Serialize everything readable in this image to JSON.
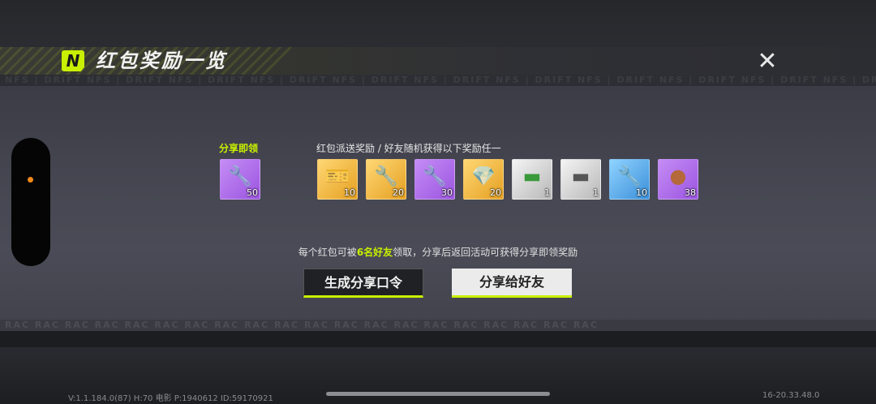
{
  "header": {
    "logo_letter": "N",
    "title": "红包奖励一览",
    "close_symbol": "✕"
  },
  "ticker_text": "NFS | DRIFT  NFS | DRIFT  NFS | DRIFT  NFS | DRIFT  NFS | DRIFT  NFS | DRIFT  NFS | DRIFT  NFS | DRIFT  NFS | DRIFT  NFS | DRIFT  NFS | DRIFT",
  "ticker2_text": "RAC   RAC   RAC   RAC   RAC   RAC   RAC   RAC   RAC   RAC   RAC   RAC   RAC   RAC   RAC   RAC   RAC   RAC   RAC   RAC",
  "share_section": {
    "label": "分享即领",
    "item": {
      "icon": "wrench-icon",
      "rarity": "purple",
      "count": "50"
    }
  },
  "reward_section": {
    "label": "红包派送奖励 / 好友随机获得以下奖励任一",
    "items": [
      {
        "icon": "ticket-icon",
        "rarity": "gold",
        "count": "10"
      },
      {
        "icon": "wrench-icon",
        "rarity": "gold",
        "count": "20"
      },
      {
        "icon": "wrench-icon",
        "rarity": "purple",
        "count": "30"
      },
      {
        "icon": "diamond-icon",
        "rarity": "gold",
        "count": "20"
      },
      {
        "icon": "green-crate-icon",
        "rarity": "gray",
        "count": "1"
      },
      {
        "icon": "gray-crate-icon",
        "rarity": "gray",
        "count": "1"
      },
      {
        "icon": "wrench-icon",
        "rarity": "blue",
        "count": "10"
      },
      {
        "icon": "bronze-coin-icon",
        "rarity": "purple",
        "count": "38"
      }
    ]
  },
  "notice": {
    "prefix": "每个红包可被",
    "highlight": "6名好友",
    "suffix": "领取，分享后返回活动可获得分享即领奖励"
  },
  "buttons": {
    "generate": "生成分享口令",
    "share": "分享给好友"
  },
  "footer": {
    "version": "V:1.1.184.0(87) H:70 电影 P:1940612 ID:59170921",
    "code": "16-20.33.48.0"
  },
  "colors": {
    "accent": "#c8f000",
    "indicator": "#f08a1c"
  }
}
